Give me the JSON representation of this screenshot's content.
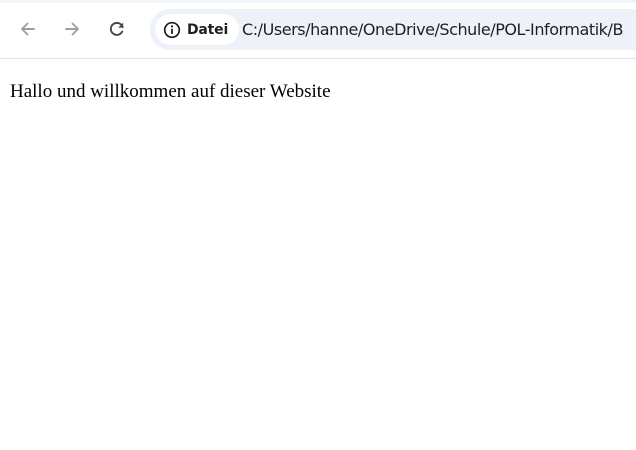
{
  "toolbar": {
    "back_icon": "arrow-left-icon",
    "forward_icon": "arrow-right-icon",
    "reload_icon": "reload-icon",
    "omnibox": {
      "security_icon": "info-icon",
      "security_label": "Datei",
      "url": "C:/Users/hanne/OneDrive/Schule/POL-Informatik/B"
    }
  },
  "page": {
    "text": "Hallo und willkommen auf dieser Website"
  },
  "colors": {
    "toolbar_bg": "#ffffff",
    "omnibox_bg": "#edf2fa",
    "icon_gray": "#9aa0a6",
    "icon_dark": "#474747",
    "text": "#1f1f1f"
  }
}
